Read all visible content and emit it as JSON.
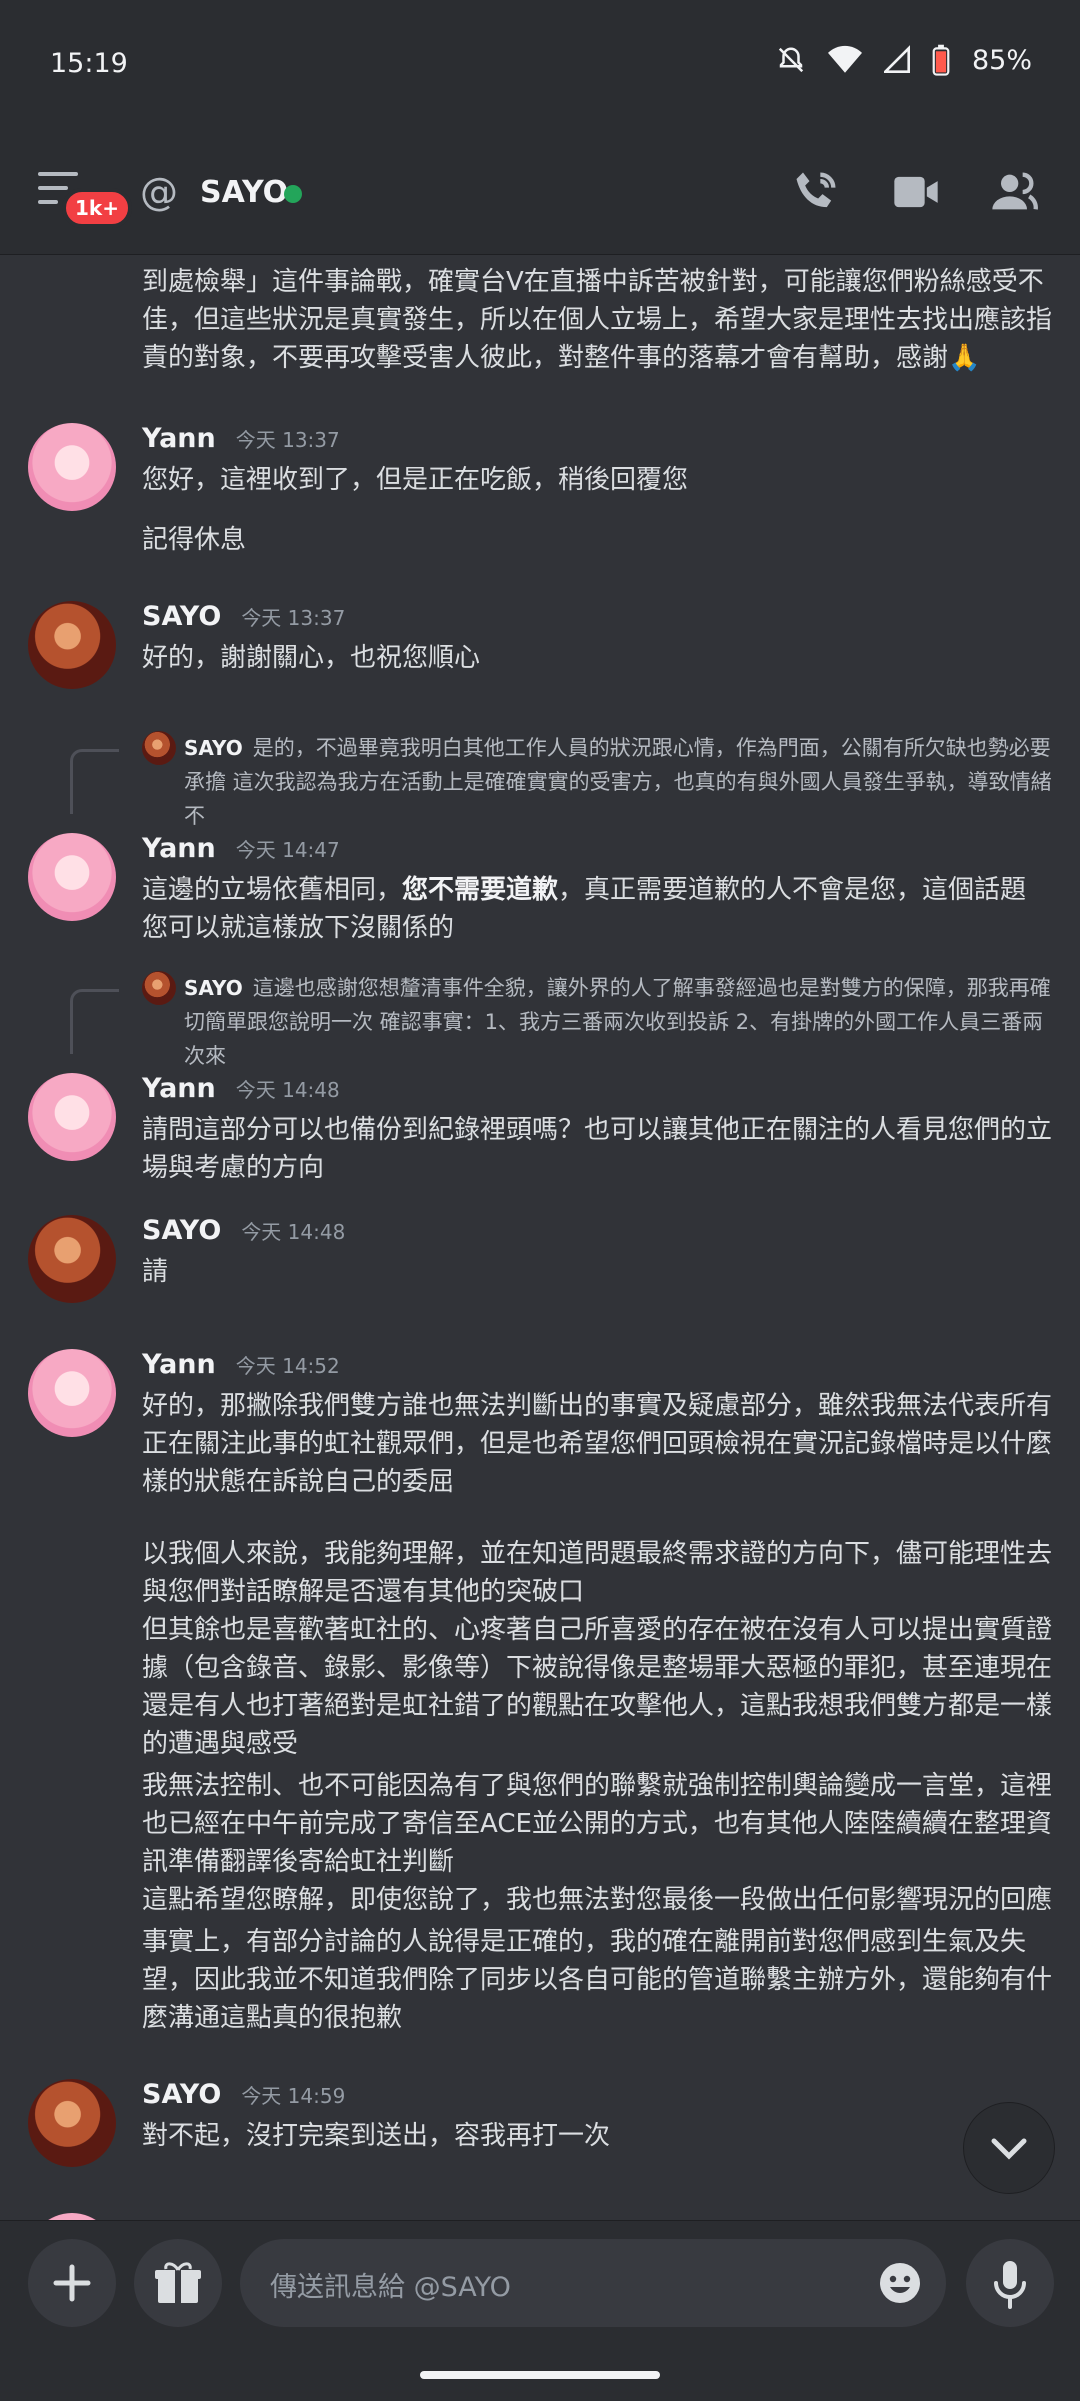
{
  "status_bar": {
    "time": "15:19",
    "battery": "85%"
  },
  "header": {
    "badge": "1k+",
    "channel_name": "SAYO",
    "at_symbol": "@"
  },
  "messages": [
    {
      "id": "cont-0",
      "lines": "到處檢舉」這件事論戰，確實台V在直播中訴苦被針對，可能讓您們粉絲感受不佳，但這些狀況是真實發生，所以在個人立場上，希望大家是理性去找出應該指責的對象，不要再攻擊受害人彼此，對整件事的落幕才會有幫助，感謝🙏"
    },
    {
      "id": "yann-1",
      "author": "Yann",
      "time": "今天 13:37",
      "body": "您好，這裡收到了，但是正在吃飯，稍後回覆您",
      "extra": "記得休息"
    },
    {
      "id": "sayo-1",
      "author": "SAYO",
      "time": "今天 13:37",
      "body": "好的，謝謝關心，也祝您順心"
    },
    {
      "id": "reply-1",
      "reply_author": "SAYO",
      "reply_text": "是的，不過畢竟我明白其他工作人員的狀況跟心情，作為門面，公關有所欠缺也勢必要承擔  這次我認為我方在活動上是確確實實的受害方，也真的有與外國人員發生爭執，導致情緒不"
    },
    {
      "id": "yann-2",
      "author": "Yann",
      "time": "今天 14:47",
      "body_pre": "這邊的立場依舊相同，",
      "body_bold": "您不需要道歉",
      "body_post": "，真正需要道歉的人不會是您，這個話題您可以就這樣放下沒關係的"
    },
    {
      "id": "reply-2",
      "reply_author": "SAYO",
      "reply_text": "這邊也感謝您想釐清事件全貌，讓外界的人了解事發經過也是對雙方的保障，那我再確切簡單跟您說明一次  確認事實：1、我方三番兩次收到投訴 2、有掛牌的外國工作人員三番兩次來"
    },
    {
      "id": "yann-3",
      "author": "Yann",
      "time": "今天 14:48",
      "body": "請問這部分可以也備份到紀錄裡頭嗎？也可以讓其他正在關注的人看見您們的立場與考慮的方向"
    },
    {
      "id": "sayo-2",
      "author": "SAYO",
      "time": "今天 14:48",
      "body": "請"
    },
    {
      "id": "yann-4",
      "author": "Yann",
      "time": "今天 14:52",
      "p1": "好的，那撇除我們雙方誰也無法判斷出的事實及疑慮部分，雖然我無法代表所有正在關注此事的虹社觀眾們，但是也希望您們回頭檢視在實況記錄檔時是以什麼樣的狀態在訴說自己的委屈",
      "p2": "以我個人來說，我能夠理解，並在知道問題最終需求證的方向下，儘可能理性去與您們對話瞭解是否還有其他的突破口",
      "p3": "但其餘也是喜歡著虹社的、心疼著自己所喜愛的存在被在沒有人可以提出實質證據（包含錄音、錄影、影像等）下被說得像是整場罪大惡極的罪犯，甚至連現在還是有人也打著絕對是虹社錯了的觀點在攻擊他人，這點我想我們雙方都是一樣的遭遇與感受",
      "p4": "我無法控制、也不可能因為有了與您們的聯繫就強制控制輿論變成一言堂，這裡也已經在中午前完成了寄信至ACE並公開的方式，也有其他人陸陸續續在整理資訊準備翻譯後寄給虹社判斷",
      "p5": "這點希望您瞭解，即使您說了，我也無法對您最後一段做出任何影響現況的回應",
      "p6": "事實上，有部分討論的人說得是正確的，我的確在離開前對您們感到生氣及失望，因此我並不知道我們除了同步以各自可能的管道聯繫主辦方外，還能夠有什麼溝通這點真的很抱歉"
    },
    {
      "id": "sayo-3",
      "author": "SAYO",
      "time": "今天 14:59",
      "body": "對不起，沒打完案到送出，容我再打一次"
    }
  ],
  "composer": {
    "placeholder": "傳送訊息給 @SAYO"
  }
}
